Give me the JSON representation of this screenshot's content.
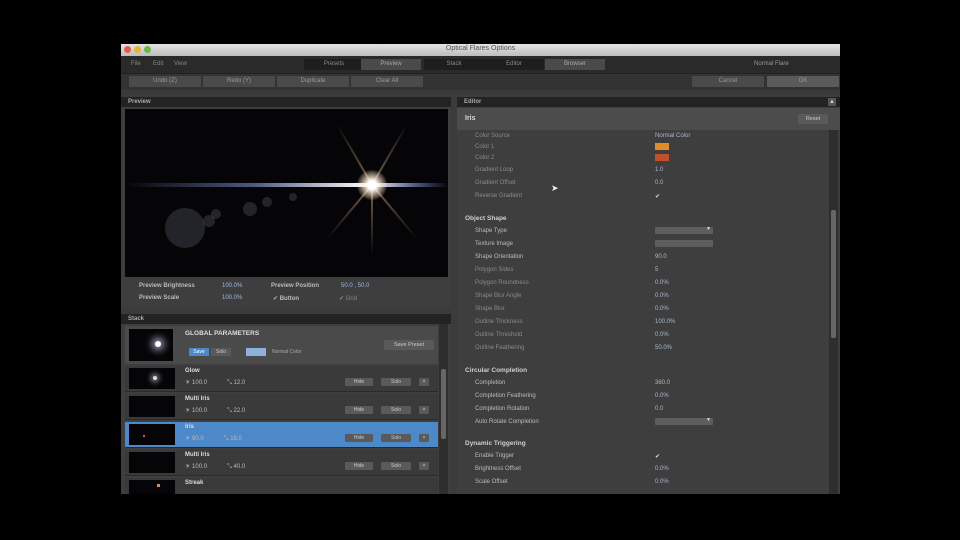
{
  "window": {
    "title": "Optical Flares Options"
  },
  "menu": [
    "File",
    "Edit",
    "View"
  ],
  "modes": [
    "Presets",
    "Preview",
    "Stack",
    "Editor",
    "Browser"
  ],
  "right_label": "Normal Flare",
  "toolbar": {
    "left": [
      "Undo (Z)",
      "Redo (Y)",
      "Duplicate",
      "Clear All"
    ],
    "cancel": "Cancel",
    "ok": "OK"
  },
  "preview": {
    "header": "Preview",
    "brightness_label": "Preview Brightness",
    "brightness_value": "100.0%",
    "scale_label": "Preview Scale",
    "scale_value": "100.0%",
    "position_label": "Preview Position",
    "position_value": "50.0 , 50.0",
    "button_label": "Button",
    "grid_label": "Grid"
  },
  "stack": {
    "header": "Stack",
    "global_title": "GLOBAL PARAMETERS",
    "global_btn_a": "Save",
    "global_btn_b": "Solo",
    "global_btn_c": "Normal Color",
    "save_preset": "Save Preset",
    "items": [
      {
        "name": "Glow",
        "v1": "100.0",
        "v2": "12.0"
      },
      {
        "name": "Multi Iris",
        "v1": "100.0",
        "v2": "22.0"
      },
      {
        "name": "Iris",
        "v1": "90.0",
        "v2": "18.0"
      },
      {
        "name": "Multi Iris",
        "v1": "100.0",
        "v2": "40.0"
      },
      {
        "name": "Streak",
        "v1": "",
        "v2": ""
      }
    ],
    "btn_hide": "Hide",
    "btn_solo": "Solo"
  },
  "editor": {
    "header": "Editor",
    "selected": "Iris",
    "reset": "Reset",
    "top_rows": [
      {
        "label": "Color Source",
        "value": "Normal Color"
      },
      {
        "label": "Color 1",
        "value": "swatch-orange"
      },
      {
        "label": "Color 2",
        "value": "swatch-red"
      },
      {
        "label": "Gradient Loop",
        "value": "1.0"
      },
      {
        "label": "Gradient Offset",
        "value": "0.0"
      },
      {
        "label": "Reverse Gradient",
        "value": "check"
      }
    ],
    "sections": [
      {
        "title": "Object Shape",
        "rows": [
          {
            "label": "Shape Type",
            "value": "dropdown"
          },
          {
            "label": "Texture Image",
            "value": "dropdown"
          },
          {
            "label": "Shape Orientation",
            "value": "90.0"
          },
          {
            "label": "Polygon Sides",
            "value": "5"
          },
          {
            "label": "Polygon Roundness",
            "value": "0.0%"
          },
          {
            "label": "Shape Blur Angle",
            "value": "0.0%"
          },
          {
            "label": "Shape Blur",
            "value": "0.0%"
          },
          {
            "label": "Outline Thickness",
            "value": "100.0%"
          },
          {
            "label": "Outline Threshold",
            "value": "0.0%"
          },
          {
            "label": "Outline Feathering",
            "value": "50.0%"
          }
        ]
      },
      {
        "title": "Circular Completion",
        "rows": [
          {
            "label": "Completion",
            "value": "360.0"
          },
          {
            "label": "Completion Feathering",
            "value": "0.0%"
          },
          {
            "label": "Completion Rotation",
            "value": "0.0"
          },
          {
            "label": "Auto Rotate Completion",
            "value": "dropdown"
          }
        ]
      },
      {
        "title": "Dynamic Triggering",
        "rows": [
          {
            "label": "Enable Trigger",
            "value": "check"
          },
          {
            "label": "Brightness Offset",
            "value": "0.0%"
          },
          {
            "label": "Scale Offset",
            "value": "0.0%"
          }
        ]
      }
    ]
  }
}
